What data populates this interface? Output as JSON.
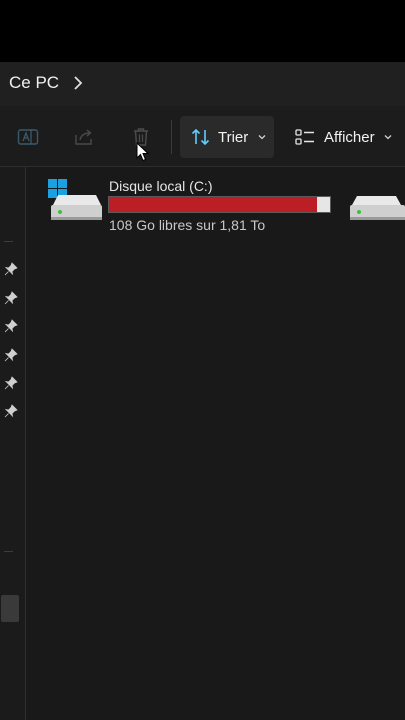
{
  "breadcrumb": {
    "current": "Ce PC"
  },
  "toolbar": {
    "sort_label": "Trier",
    "view_label": "Afficher",
    "icons": [
      "rename-icon",
      "share-icon",
      "delete-icon",
      "sort-icon",
      "view-icon"
    ]
  },
  "drive": {
    "name": "Disque local (C:)",
    "space_text": "108 Go libres sur 1,81 To",
    "used_fraction": 0.94,
    "bar_color": "#bb1e24"
  },
  "colors": {
    "accent": "#60cdff",
    "windows_logo": "#1ba1e2"
  }
}
